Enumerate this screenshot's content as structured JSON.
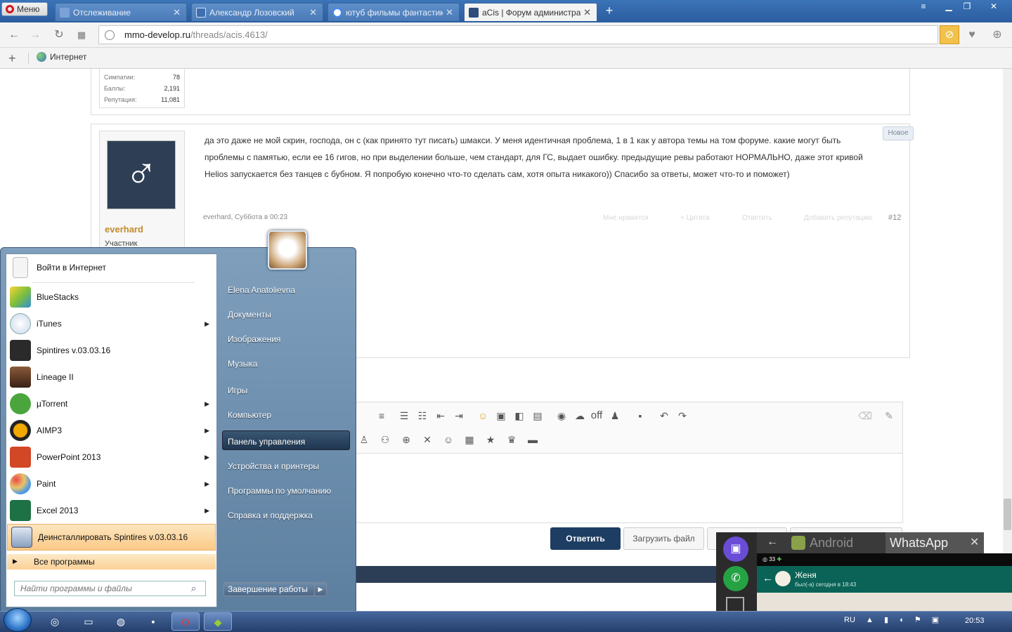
{
  "browser": {
    "menu_label": "Меню",
    "tabs": [
      {
        "title": "Отслеживание",
        "icon": "shield-icon",
        "active": false
      },
      {
        "title": "Александр Лозовский",
        "icon": "page-icon",
        "active": false
      },
      {
        "title": "ютуб фильмы фантастика",
        "icon": "google-icon",
        "active": false
      },
      {
        "title": "aCis | Форум администрат",
        "icon": "forum-icon",
        "active": true
      }
    ],
    "address": {
      "host": "mmo-develop.ru",
      "path": "/threads/acis.4613/"
    },
    "bookmarks": [
      {
        "label": "Интернет",
        "icon": "globe-icon"
      }
    ]
  },
  "forum": {
    "prev_stats": [
      {
        "label": "Симпатии:",
        "value": "78"
      },
      {
        "label": "Баллы:",
        "value": "2,191"
      },
      {
        "label": "Репутация:",
        "value": "11,081"
      }
    ],
    "post": {
      "author": "everhard",
      "role": "Участник",
      "avatar_glyph": "♂",
      "text": "да это даже не мой скрин, господа, он с (как принято тут писать) шмакси. У меня идентичная проблема, 1 в 1 как у автора темы на том форуме. какие могут быть проблемы с памятью, если ее 16 гигов, но при выделении больше, чем стандарт, для ГС, выдает ошибку. предыдущие ревы работают НОРМАЛЬНО, даже этот кривой Helios запускается без танцев с бубном. Я попробую конечно что-то сделать сам, хотя опыта никакого)) Спасибо за ответы, может что-то и поможет)",
      "badge": "Новое",
      "meta": "everhard, Суббота в 00:23",
      "actions": [
        "Мне нравится",
        "+ Цитата",
        "Ответить",
        "Добавить репутацию"
      ],
      "number": "#12"
    },
    "editor": {
      "toolbar_off": "off",
      "reply_label": "Ответить",
      "upload_label": "Загрузить файл"
    }
  },
  "start_menu": {
    "items": [
      {
        "label": "Войти в Интернет",
        "icon": "document-icon",
        "arrow": false,
        "color": "#f4f4f4"
      },
      {
        "label": "BlueStacks",
        "icon": "bluestacks-icon",
        "arrow": false,
        "color": "#7fbf3a"
      },
      {
        "label": "iTunes",
        "icon": "itunes-icon",
        "arrow": true,
        "color": "#c9d7ea"
      },
      {
        "label": "Spintires v.03.03.16",
        "icon": "spintires-icon",
        "arrow": false,
        "color": "#2a2a2a"
      },
      {
        "label": "Lineage II",
        "icon": "lineage-icon",
        "arrow": false,
        "color": "#5a3a2a"
      },
      {
        "label": "µTorrent",
        "icon": "utorrent-icon",
        "arrow": true,
        "color": "#4aa53c"
      },
      {
        "label": "AIMP3",
        "icon": "aimp-icon",
        "arrow": true,
        "color": "#f2a900"
      },
      {
        "label": "PowerPoint 2013",
        "icon": "powerpoint-icon",
        "arrow": true,
        "color": "#d24726"
      },
      {
        "label": "Paint",
        "icon": "paint-icon",
        "arrow": true,
        "color": "#e8c46a"
      },
      {
        "label": "Excel 2013",
        "icon": "excel-icon",
        "arrow": true,
        "color": "#1e7145"
      },
      {
        "label": "Деинсталлировать Spintires v.03.03.16",
        "icon": "uninstall-icon",
        "arrow": false,
        "color": "#8aa0c0"
      }
    ],
    "all_programs": "Все программы",
    "search_placeholder": "Найти программы и файлы",
    "right_items": [
      "Elena Anatolievna",
      "Документы",
      "Изображения",
      "Музыка",
      "Игры",
      "Компьютер",
      "Панель управления",
      "Устройства и принтеры",
      "Программы по умолчанию",
      "Справка и поддержка"
    ],
    "shutdown": "Завершение работы"
  },
  "overlay": {
    "android_label": "Android",
    "whatsapp_label": "WhatsApp",
    "status_count": "33",
    "contact_name": "Женя",
    "last_seen": "был(-а) сегодня в 18:43"
  },
  "taskbar": {
    "lang": "RU",
    "clock": "20:53"
  }
}
